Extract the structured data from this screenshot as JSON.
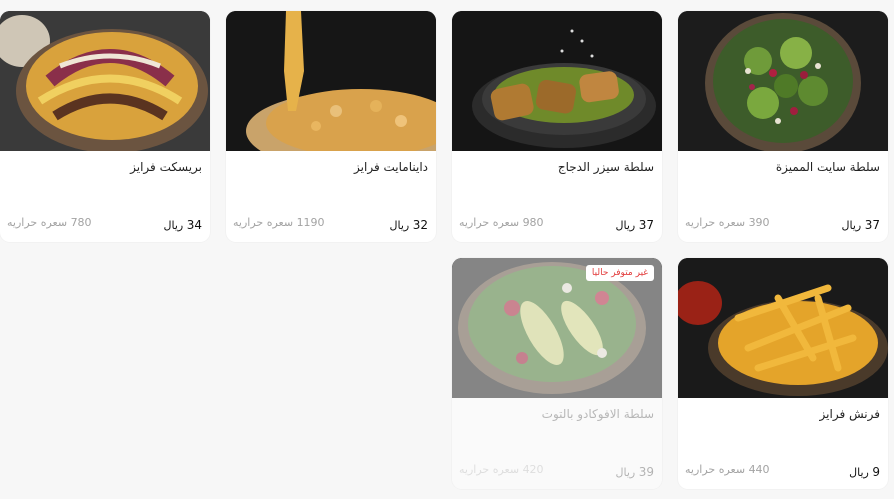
{
  "menu": {
    "items": [
      {
        "name": "سلطة سايت المميزة",
        "price": "37",
        "currency": "ريال",
        "calories": "390",
        "calories_unit": "سعره حراريه",
        "available": true
      },
      {
        "name": "سلطة سيزر الدجاج",
        "price": "37",
        "currency": "ريال",
        "calories": "980",
        "calories_unit": "سعره حراريه",
        "available": true
      },
      {
        "name": "داينامايت فرايز",
        "price": "32",
        "currency": "ريال",
        "calories": "1190",
        "calories_unit": "سعره حراريه",
        "available": true
      },
      {
        "name": "بريسكت فرايز",
        "price": "34",
        "currency": "ريال",
        "calories": "780",
        "calories_unit": "سعره حراريه",
        "available": true
      },
      {
        "name": "فرنش فرايز",
        "price": "9",
        "currency": "ريال",
        "calories": "440",
        "calories_unit": "سعره حراريه",
        "available": true
      },
      {
        "name": "سلطة الافوكادو بالتوت",
        "price": "39",
        "currency": "ريال",
        "calories": "420",
        "calories_unit": "سعره حراريه",
        "available": false,
        "badge": "غير متوفر حاليا"
      }
    ]
  },
  "colors": {
    "page_bg": "#f7f7f7",
    "card_bg": "#ffffff",
    "badge_text": "#e23b3b",
    "muted_text": "#a3a3a3"
  }
}
